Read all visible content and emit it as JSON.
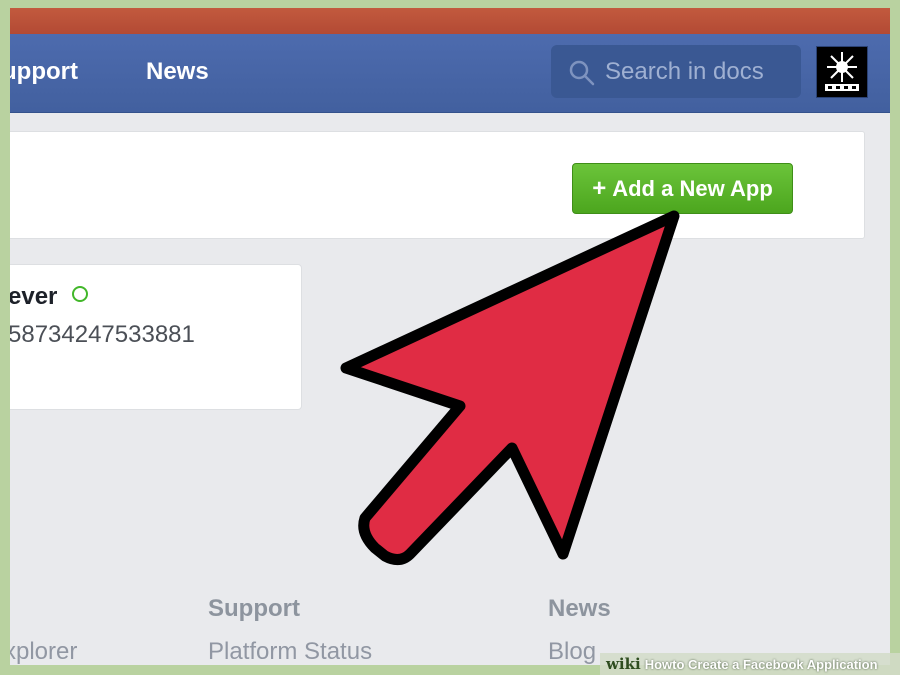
{
  "nav": {
    "items": [
      {
        "label": "upport"
      },
      {
        "label": "News"
      }
    ],
    "search": {
      "placeholder": "Search in docs",
      "icon": "search-icon"
    },
    "avatar": {
      "icon": "profile-picture"
    }
  },
  "toolbar": {
    "add_app_label": "Add a New App",
    "add_app_icon": "plus-icon"
  },
  "app_card": {
    "name": "ever",
    "app_id": "58734247533881",
    "status_color": "#42b72a"
  },
  "footer": {
    "columns": [
      {
        "links": [
          "xplorer"
        ]
      },
      {
        "heading": "Support",
        "links": [
          "Platform Status"
        ]
      },
      {
        "heading": "News",
        "links": [
          "Blog"
        ]
      }
    ]
  },
  "overlay": {
    "arrow_color": "#e02c44",
    "watermark_logo": "wiki",
    "watermark_how": "How",
    "watermark_text": " to Create a Facebook Application"
  },
  "colors": {
    "navbar": "#4a67aa",
    "accent_green": "#5cb82c",
    "top_strip": "#b9533a"
  }
}
